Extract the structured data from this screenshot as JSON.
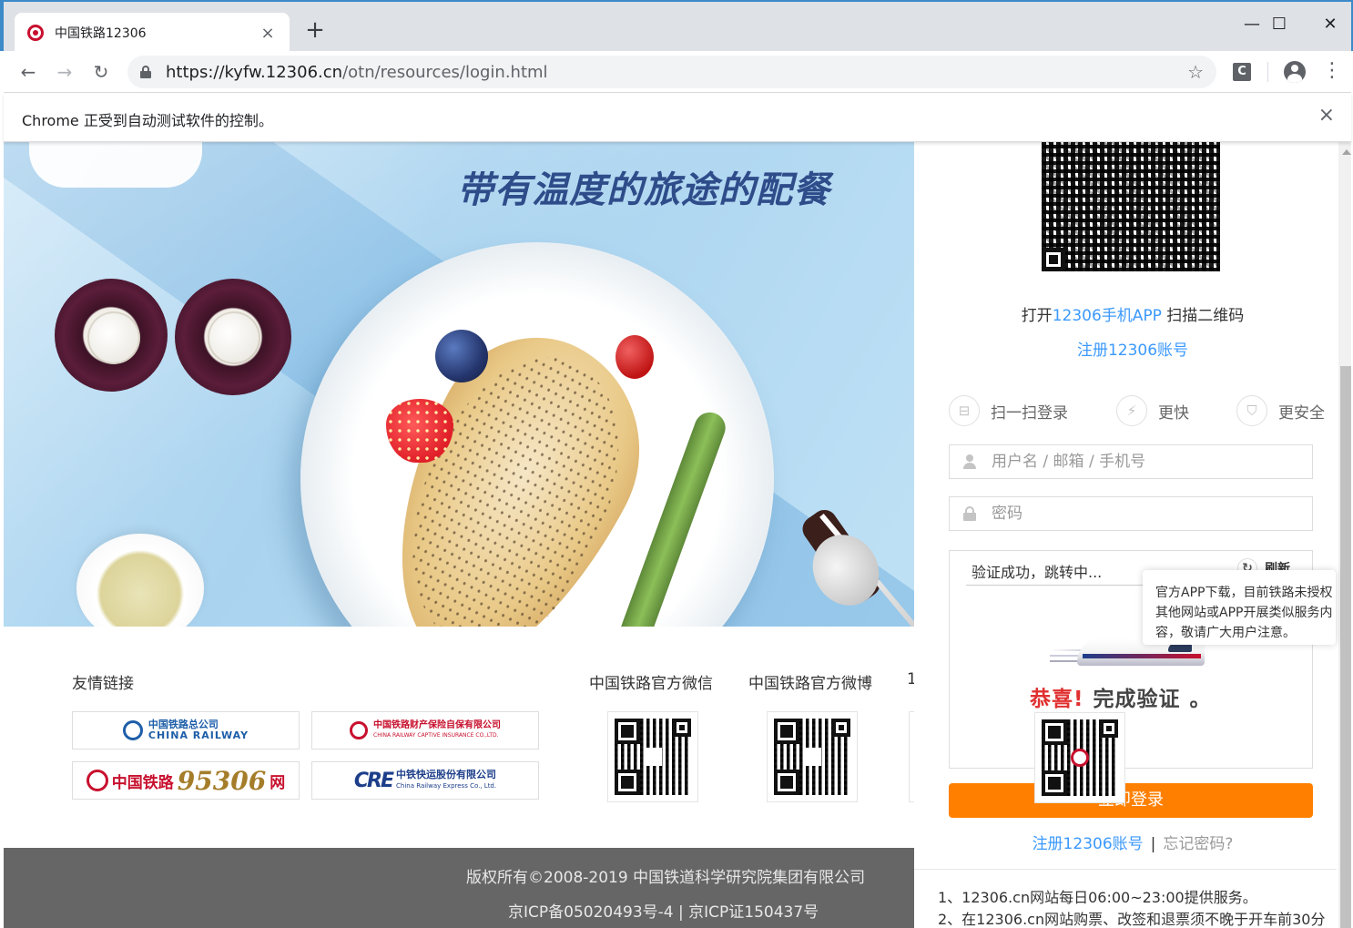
{
  "browser": {
    "tab_title": "中国铁路12306",
    "tab_close": "×",
    "new_tab": "+",
    "minimize": "—",
    "maximize": "☐",
    "close": "✕",
    "back": "←",
    "forward": "→",
    "reload": "↻",
    "url_host": "https://kyfw.12306.cn",
    "url_path": "/otn/resources/login.html",
    "star": "☆",
    "extension_letter": "C",
    "menu": "⋮",
    "infobar_text": "Chrome 正受到自动测试软件的控制。",
    "infobar_close": "×"
  },
  "banner": {
    "slogan": "带有温度的旅途的配餐"
  },
  "links": {
    "title": "友情链接",
    "logos": [
      {
        "name_cn": "中国铁路总公司",
        "name_en": "CHINA RAILWAY"
      },
      {
        "name_cn": "中国铁路财产保险自保有限公司",
        "name_en": "CHINA RAILWAY CAPTIVE INSURANCE CO.,LTD."
      },
      {
        "name_cn": "中国铁路",
        "number": "95306",
        "suffix": "网"
      },
      {
        "mark": "CRE",
        "name_cn": "中铁快运股份有限公司",
        "name_en": "China Railway Express Co., Ltd."
      }
    ],
    "qr_titles": [
      "中国铁路官方微信",
      "中国铁路官方微博",
      "1"
    ]
  },
  "footer": {
    "copyright": "版权所有©2008-2019    中国铁道科学研究院集团有限公司",
    "icp": "京ICP备05020493号-4    |    京ICP证150437号"
  },
  "login": {
    "scan_prefix": "打开",
    "scan_app": "12306手机APP",
    "scan_suffix": " 扫描二维码",
    "register": "注册12306账号",
    "features": [
      {
        "icon": "⊟",
        "label": "扫一扫登录"
      },
      {
        "icon": "⚡",
        "label": "更快"
      },
      {
        "icon": "⛉",
        "label": "更安全"
      }
    ],
    "username_placeholder": "用户名 / 邮箱 / 手机号",
    "password_placeholder": "密码",
    "captcha_status": "验证成功，跳转中...",
    "captcha_refresh": "刷新",
    "captcha_refresh_icon": "↻",
    "captcha_congrats": "恭喜!",
    "captcha_done": "完成验证",
    "captcha_dot": "。",
    "login_button": "立即登录",
    "bottom_register": "注册12306账号",
    "bottom_sep": "|",
    "forgot_password": "忘记密码?",
    "notices": [
      "1、12306.cn网站每日06:00~23:00提供服务。",
      "2、在12306.cn网站购票、改签和退票须不晚于开车前30分"
    ]
  },
  "tooltip": {
    "lines": [
      "官方APP下载，目前铁路未授权",
      "其他网站或APP开展类似服务内",
      "容，敬请广大用户注意。"
    ]
  }
}
